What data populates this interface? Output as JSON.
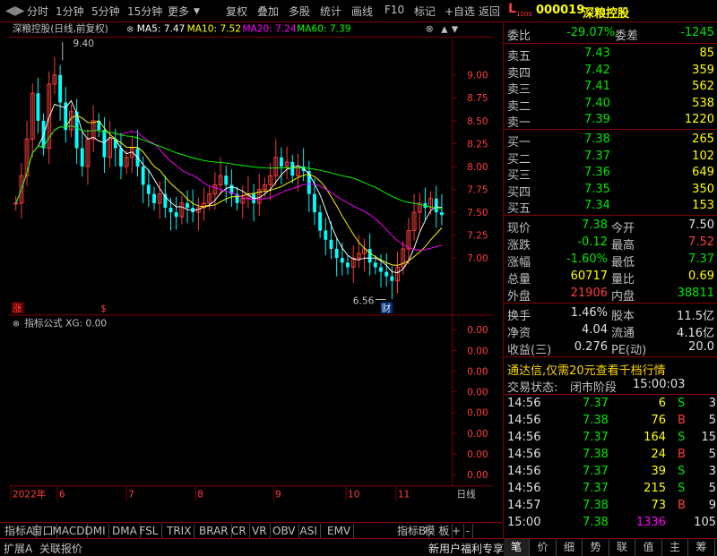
{
  "toolbar": {
    "items": [
      "分时",
      "1分钟",
      "5分钟",
      "15分钟",
      "更多",
      "复权",
      "叠加",
      "多股",
      "统计",
      "画线",
      "F10",
      "标记",
      "+自选",
      "返回"
    ],
    "stock_code": "000019",
    "stock_name": "深粮控股",
    "l_badge": "L",
    "l_sub": "1000"
  },
  "chart": {
    "header_title": "深粮控股(日线,前复权)",
    "ma": [
      {
        "label": "MA5: 7.47",
        "color": "#ffffff"
      },
      {
        "label": "MA10: 7.52",
        "color": "#ffff00"
      },
      {
        "label": "MA20: 7.24",
        "color": "#ff00ff"
      },
      {
        "label": "MA60: 7.39",
        "color": "#00ff00"
      }
    ],
    "price_ticks": [
      "9.00",
      "8.75",
      "8.50",
      "8.25",
      "8.00",
      "7.75",
      "7.50",
      "7.25",
      "7.00"
    ],
    "high_label": "9.40",
    "low_label": "6.56",
    "zhang_label": "涨",
    "s_label": "$",
    "cai_label": "财",
    "indicator_title": "指标公式 XG: 0.00",
    "indicator_ticks": [
      "0.00",
      "0.00",
      "0.00",
      "0.00",
      "0.00",
      "0.00",
      "0.00",
      "0.00"
    ],
    "time_labels": [
      "2022年",
      "6",
      "7",
      "8",
      "9",
      "10",
      "11"
    ],
    "period": "日线",
    "colors": {
      "up": "#ff3c3c",
      "down": "#00ffff",
      "ma5": "#ffffff",
      "ma10": "#ffff00",
      "ma20": "#ff00ff",
      "ma60": "#00ff00",
      "axis": "#800000"
    }
  },
  "chart_data": {
    "type": "candlestick",
    "title": "深粮控股(日线,前复权)",
    "ylim": [
      6.5,
      9.5
    ],
    "series": [
      {
        "name": "MA5",
        "values": [
          7.47
        ]
      },
      {
        "name": "MA10",
        "values": [
          7.52
        ]
      },
      {
        "name": "MA20",
        "values": [
          7.24
        ]
      },
      {
        "name": "MA60",
        "values": [
          7.39
        ]
      }
    ],
    "annotations": [
      {
        "label": "9.40",
        "value": 9.4
      },
      {
        "label": "6.56",
        "value": 6.56
      }
    ]
  },
  "indicator_tabs": [
    "指标A",
    "窗口",
    "MACD",
    "DMI",
    "DMA",
    "FSL",
    "TRIX",
    "BRAR",
    "CR",
    "VR",
    "OBV",
    "ASI",
    "EMV",
    "指标B",
    "模 板",
    "+",
    "-"
  ],
  "quote": {
    "weibi_label": "委比",
    "weibi": "-29.07%",
    "weicha_label": "委差",
    "weicha": "-1245",
    "asks": [
      {
        "label": "卖五",
        "price": "7.43",
        "vol": "85"
      },
      {
        "label": "卖四",
        "price": "7.42",
        "vol": "359"
      },
      {
        "label": "卖三",
        "price": "7.41",
        "vol": "562"
      },
      {
        "label": "卖二",
        "price": "7.40",
        "vol": "538"
      },
      {
        "label": "卖一",
        "price": "7.39",
        "vol": "1220"
      }
    ],
    "bids": [
      {
        "label": "买一",
        "price": "7.38",
        "vol": "265"
      },
      {
        "label": "买二",
        "price": "7.37",
        "vol": "102"
      },
      {
        "label": "买三",
        "price": "7.36",
        "vol": "649"
      },
      {
        "label": "买四",
        "price": "7.35",
        "vol": "350"
      },
      {
        "label": "买五",
        "price": "7.34",
        "vol": "153"
      }
    ],
    "stats": [
      {
        "l1": "现价",
        "v1": "7.38",
        "c1": "green",
        "l2": "今开",
        "v2": "7.50",
        "c2": "white"
      },
      {
        "l1": "涨跌",
        "v1": "-0.12",
        "c1": "green",
        "l2": "最高",
        "v2": "7.52",
        "c2": "red"
      },
      {
        "l1": "涨幅",
        "v1": "-1.60%",
        "c1": "green",
        "l2": "最低",
        "v2": "7.37",
        "c2": "green"
      },
      {
        "l1": "总量",
        "v1": "60717",
        "c1": "yellow",
        "l2": "量比",
        "v2": "0.69",
        "c2": "yellow"
      },
      {
        "l1": "外盘",
        "v1": "21906",
        "c1": "red",
        "l2": "内盘",
        "v2": "38811",
        "c2": "green"
      }
    ],
    "stats2": [
      {
        "l1": "换手",
        "v1": "1.46%",
        "l2": "股本",
        "v2": "11.5亿"
      },
      {
        "l1": "净资",
        "v1": "4.04",
        "l2": "流通",
        "v2": "4.16亿"
      },
      {
        "l1": "收益(三)",
        "v1": "0.276",
        "l2": "PE(动)",
        "v2": "20.0"
      }
    ],
    "promo": "通达信,仅需20元查看千档行情",
    "status_label": "交易状态:",
    "status_value": "闭市阶段",
    "status_time": "15:00:03",
    "ticks": [
      {
        "t": "14:56",
        "p": "7.37",
        "v": "6",
        "d": "S",
        "n": "3"
      },
      {
        "t": "14:56",
        "p": "7.38",
        "v": "76",
        "d": "B",
        "n": "5"
      },
      {
        "t": "14:56",
        "p": "7.37",
        "v": "164",
        "d": "S",
        "n": "15"
      },
      {
        "t": "14:56",
        "p": "7.38",
        "v": "24",
        "d": "B",
        "n": "5"
      },
      {
        "t": "14:56",
        "p": "7.37",
        "v": "39",
        "d": "S",
        "n": "3"
      },
      {
        "t": "14:56",
        "p": "7.37",
        "v": "215",
        "d": "S",
        "n": "5"
      },
      {
        "t": "14:57",
        "p": "7.38",
        "v": "73",
        "d": "B",
        "n": "9"
      },
      {
        "t": "15:00",
        "p": "7.38",
        "v": "1336",
        "d": "",
        "n": "105"
      }
    ]
  },
  "status_bar": {
    "left": [
      "扩展A",
      "关联报价"
    ],
    "promo": "新用户福利专享",
    "right_tabs": [
      "笔",
      "价",
      "细",
      "势",
      "联",
      "值",
      "主",
      "筹"
    ]
  }
}
